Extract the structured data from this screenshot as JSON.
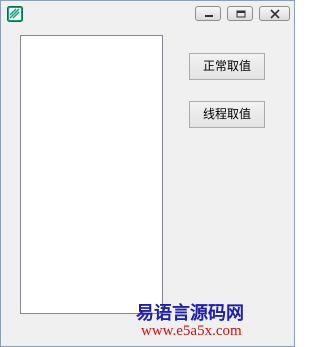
{
  "window": {
    "title": "",
    "controls": {
      "minimize_icon": "minimize-icon",
      "maximize_icon": "maximize-icon",
      "close_icon": "close-icon"
    }
  },
  "list": {
    "items": []
  },
  "buttons": {
    "normal_label": "正常取值",
    "thread_label": "线程取值"
  },
  "watermark": {
    "site_name": "易语言源码网",
    "url": "www.e5a5x.com"
  }
}
